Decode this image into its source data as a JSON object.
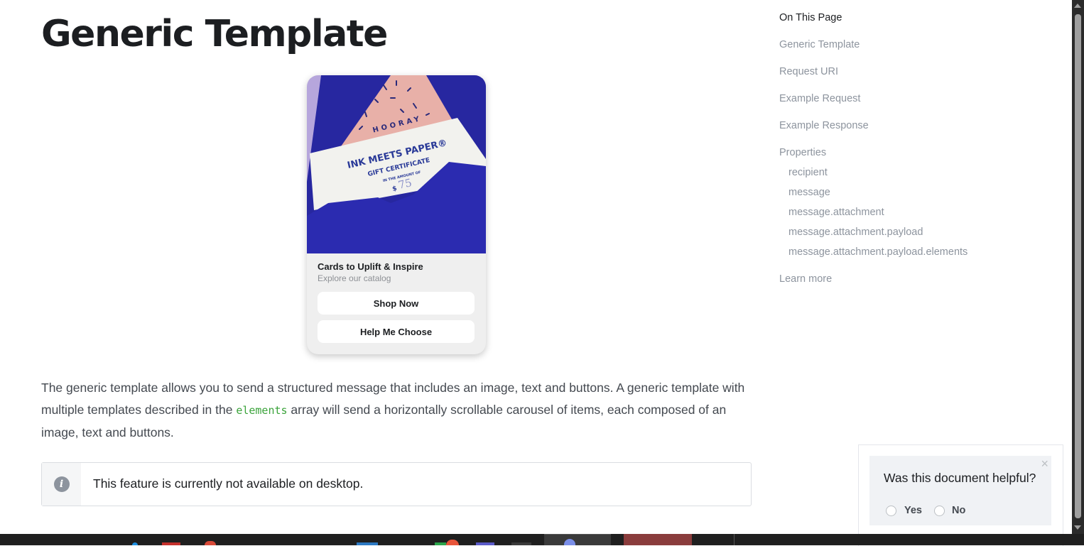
{
  "page": {
    "title": "Generic Template"
  },
  "preview": {
    "envelope_card": {
      "hooray": "HOORAY",
      "brand": "INK MEETS PAPER®",
      "cert": "GIFT CERTIFICATE",
      "amount_line": "IN THE AMOUNT OF",
      "currency": "$",
      "amount": "75"
    },
    "card_title": "Cards to Uplift & Inspire",
    "card_subtitle": "Explore our catalog",
    "buttons": [
      {
        "label": "Shop Now"
      },
      {
        "label": "Help Me Choose"
      }
    ]
  },
  "body": {
    "para_part1": "The generic template allows you to send a structured message that includes an image, text and buttons. A generic template with multiple templates described in the ",
    "para_code": "elements",
    "para_part2": " array will send a horizontally scrollable carousel of items, each composed of an image, text and buttons."
  },
  "notice": {
    "text": "This feature is currently not available on desktop.",
    "icon": "info-icon"
  },
  "toc": {
    "heading": "On This Page",
    "items": [
      {
        "label": "Generic Template",
        "level": 1
      },
      {
        "label": "Request URI",
        "level": 1
      },
      {
        "label": "Example Request",
        "level": 1
      },
      {
        "label": "Example Response",
        "level": 1
      },
      {
        "label": "Properties",
        "level": 1
      },
      {
        "label": "recipient",
        "level": 2
      },
      {
        "label": "message",
        "level": 2
      },
      {
        "label": "message.attachment",
        "level": 2
      },
      {
        "label": "message.attachment.payload",
        "level": 2
      },
      {
        "label": "message.attachment.payload.elements",
        "level": 2
      },
      {
        "label": "Learn more",
        "level": 1
      }
    ]
  },
  "feedback": {
    "question": "Was this document helpful?",
    "yes": "Yes",
    "no": "No",
    "close": "×"
  },
  "colors": {
    "code": "#3aa33a",
    "muted_link": "#8d949e",
    "envelope_blue": "#2a2aa8",
    "photo_background": "#b6a6dc"
  }
}
